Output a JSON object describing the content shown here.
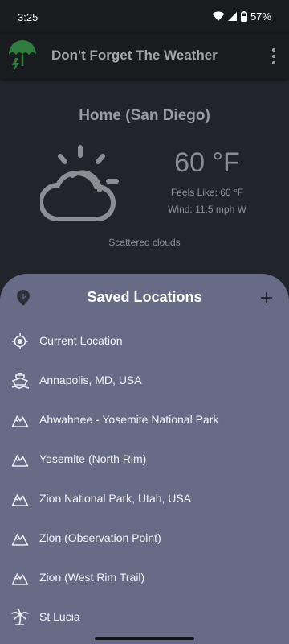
{
  "status_bar": {
    "time": "3:25",
    "battery": "57%"
  },
  "app_bar": {
    "title": "Don't Forget The Weather",
    "logo_icon": "umbrella-lightning-icon",
    "menu_icon": "overflow-menu-icon"
  },
  "weather": {
    "location": "Home (San Diego)",
    "temperature": "60 °F",
    "feels_like": "Feels Like: 60 °F",
    "wind": "Wind: 11.5 mph W",
    "description": "Scattered clouds",
    "icon": "partly-cloudy-icon"
  },
  "sheet": {
    "title": "Saved Locations",
    "items": [
      {
        "label": "Current Location",
        "icon": "crosshair-icon"
      },
      {
        "label": "Annapolis, MD, USA",
        "icon": "ship-icon"
      },
      {
        "label": "Ahwahnee - Yosemite National Park",
        "icon": "mountain-icon"
      },
      {
        "label": "Yosemite (North Rim)",
        "icon": "mountain-icon"
      },
      {
        "label": "Zion National Park, Utah, USA",
        "icon": "mountain-icon"
      },
      {
        "label": "Zion (Observation Point)",
        "icon": "mountain-icon"
      },
      {
        "label": "Zion (West Rim Trail)",
        "icon": "mountain-icon"
      },
      {
        "label": "St Lucia",
        "icon": "palm-tree-icon"
      }
    ]
  },
  "colors": {
    "background": "#22242b",
    "app_bar": "#1a1b1f",
    "sheet": "#676b85",
    "logo_green": "#2f7d3f",
    "muted_text": "#8d8e94"
  }
}
